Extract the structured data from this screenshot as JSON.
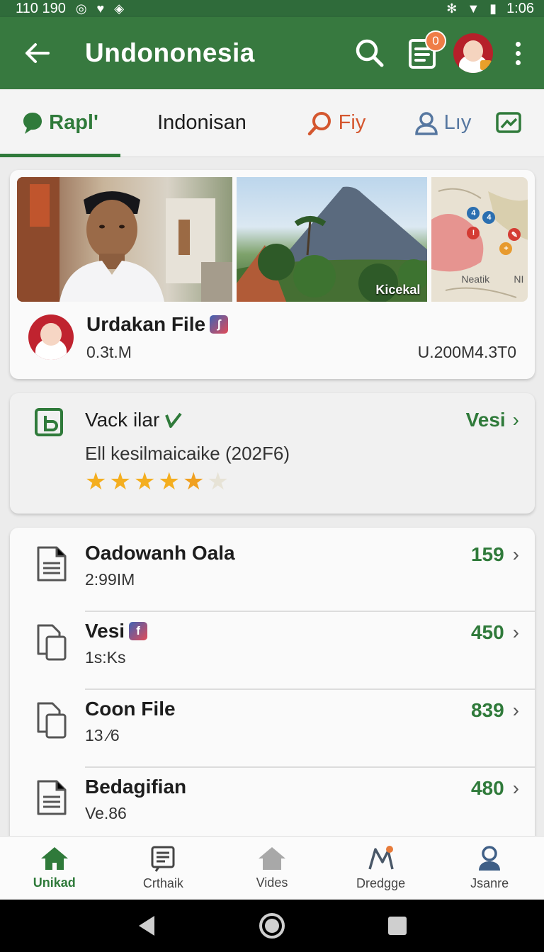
{
  "status": {
    "left_time": "110 190",
    "right_time": "1:06"
  },
  "appbar": {
    "title": "Undononesia",
    "notif_count": "0"
  },
  "tabs": [
    {
      "label": "Rapl'"
    },
    {
      "label": "Indonisan"
    },
    {
      "label": "Fiy"
    },
    {
      "label": "Lıy"
    }
  ],
  "feature": {
    "image_caption": "Kicekal",
    "map_label": "Neatik",
    "map_label2": "NI",
    "title": "Urdakan File",
    "title_badge": "ʃ",
    "sub_left": "0.3t.M",
    "sub_right": "U.200M4.3T0"
  },
  "rating": {
    "title": "Vack ilar",
    "link": "Vesi",
    "desc": "Ell kesilmaicaike (202F6)",
    "stars": 4.5,
    "max_stars": 6
  },
  "files": [
    {
      "title": "Oadowanh Oala",
      "sub": "2:99IM",
      "count": "159",
      "badge": ""
    },
    {
      "title": "Vesi",
      "sub": "1s:Ks",
      "count": "450",
      "badge": "f"
    },
    {
      "title": "Coon File",
      "sub": "13 ⁄6",
      "count": "839",
      "badge": ""
    },
    {
      "title": "Bedagifian",
      "sub": "Ve.86",
      "count": "480",
      "badge": ""
    }
  ],
  "bottom_nav": [
    {
      "label": "Unikad",
      "icon": "home-icon"
    },
    {
      "label": "Crthaik",
      "icon": "list-icon"
    },
    {
      "label": "Vides",
      "icon": "home-outline-icon"
    },
    {
      "label": "Dredgge",
      "icon": "map-pin-icon"
    },
    {
      "label": "Jsanre",
      "icon": "person-icon"
    }
  ],
  "colors": {
    "primary": "#37793f",
    "accent_orange": "#ef7d47",
    "star": "#f4ae1f"
  }
}
